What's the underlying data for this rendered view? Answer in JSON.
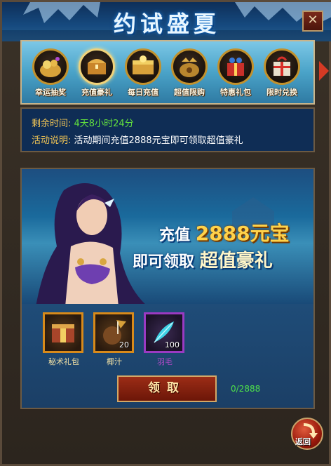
{
  "header": {
    "title": "约试盛夏",
    "close_label": "✕"
  },
  "tabs": [
    {
      "label": "幸运抽奖",
      "icon": "lucky-draw-icon",
      "selected": false
    },
    {
      "label": "充值豪礼",
      "icon": "treasure-chest-icon",
      "selected": true
    },
    {
      "label": "每日充值",
      "icon": "gold-chest-icon",
      "selected": false
    },
    {
      "label": "超值限购",
      "icon": "dragon-cauldron-icon",
      "selected": false
    },
    {
      "label": "特惠礼包",
      "icon": "gift-box-icon",
      "selected": false
    },
    {
      "label": "限时兑换",
      "icon": "exchange-gift-icon",
      "selected": false
    }
  ],
  "info": {
    "remaining_key": "剩余时间:",
    "remaining_value": "4天8小时24分",
    "desc_key": "活动说明:",
    "desc_value": "活动期间充值2888元宝即可领取超值豪礼"
  },
  "banner": {
    "line1_prefix": "充值",
    "line1_amount": "2888元宝",
    "line2_prefix": "即可领取",
    "line2_highlight": "超值豪礼"
  },
  "rewards": [
    {
      "name": "秘术礼包",
      "count": "",
      "icon": "spellbook-gift-icon",
      "rarity": "orange"
    },
    {
      "name": "椰汁",
      "count": "20",
      "icon": "coconut-juice-icon",
      "rarity": "orange"
    },
    {
      "name": "羽毛",
      "count": "100",
      "icon": "feather-icon",
      "rarity": "purple"
    }
  ],
  "claim_label": "领取",
  "progress_text": "0/2888",
  "back_label": "返回",
  "colors": {
    "accent_gold": "#f0c455",
    "timer_green": "#62e03e",
    "progress_green": "#4ee14a"
  }
}
